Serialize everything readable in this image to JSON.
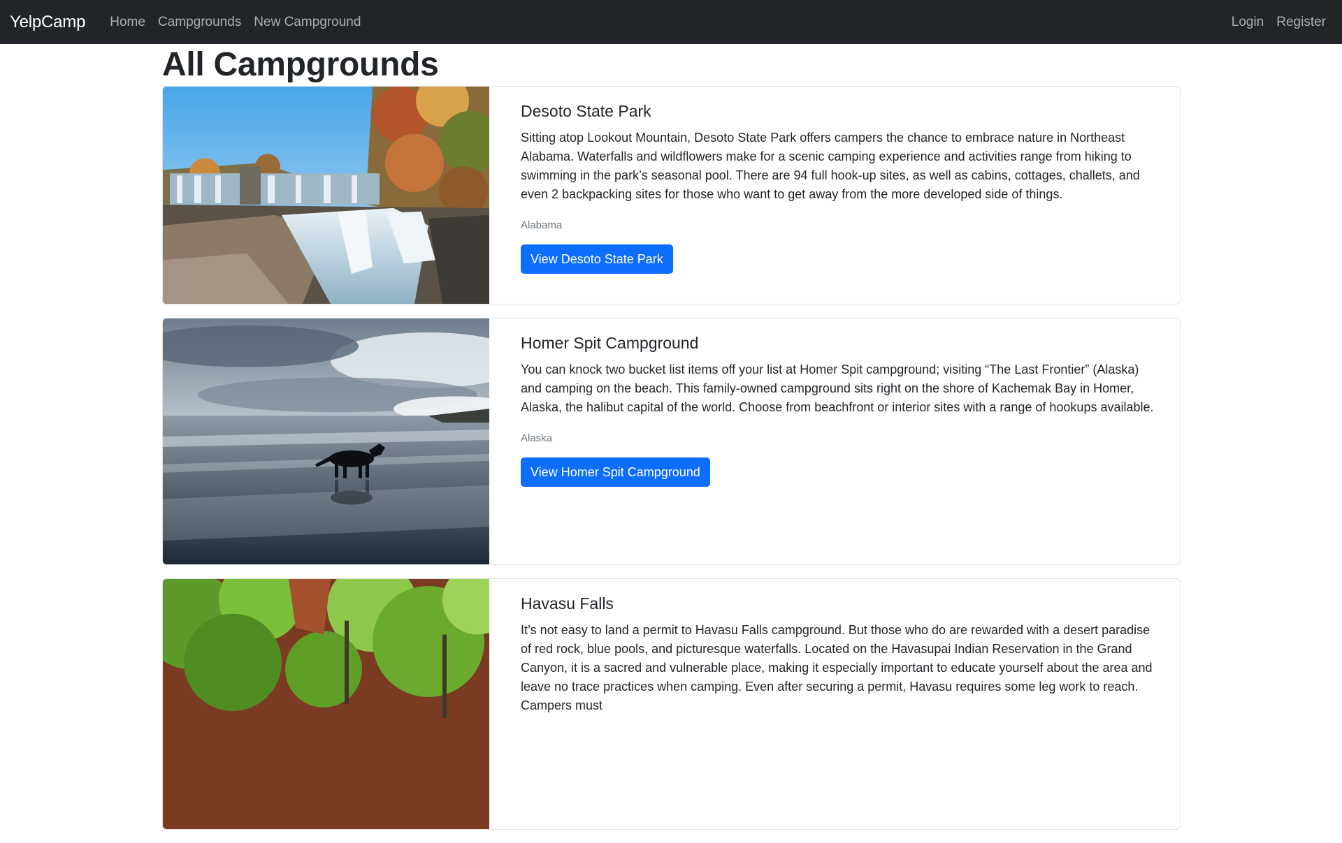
{
  "navbar": {
    "brand": "YelpCamp",
    "links": [
      "Home",
      "Campgrounds",
      "New Campground"
    ],
    "right_links": [
      "Login",
      "Register"
    ]
  },
  "page": {
    "title": "All Campgrounds"
  },
  "campgrounds": [
    {
      "title": "Desoto State Park",
      "description": "Sitting atop Lookout Mountain, Desoto State Park offers campers the chance to embrace nature in Northeast Alabama. Waterfalls and wildflowers make for a scenic camping experience and activities range from hiking to swimming in the park’s seasonal pool. There are 94 full hook-up sites, as well as cabins, cottages, challets, and even 2 backpacking sites for those who want to get away from the more developed side of things.",
      "location": "Alabama",
      "button": "View Desoto State Park"
    },
    {
      "title": "Homer Spit Campground",
      "description": "You can knock two bucket list items off your list at Homer Spit campground; visiting “The Last Frontier” (Alaska) and camping on the beach. This family-owned campground sits right on the shore of Kachemak Bay in Homer, Alaska, the halibut capital of the world. Choose from beachfront or interior sites with a range of hookups available.",
      "location": "Alaska",
      "button": "View Homer Spit Campground"
    },
    {
      "title": "Havasu Falls",
      "description": "It’s not easy to land a permit to Havasu Falls campground. But those who do are rewarded with a desert paradise of red rock, blue pools, and picturesque waterfalls. Located on the Havasupai Indian Reservation in the Grand Canyon, it is a sacred and vulnerable place, making it especially important to educate yourself about the area and leave no trace practices when camping. Even after securing a permit, Havasu requires some leg work to reach. Campers must",
      "location": "",
      "button": ""
    }
  ]
}
